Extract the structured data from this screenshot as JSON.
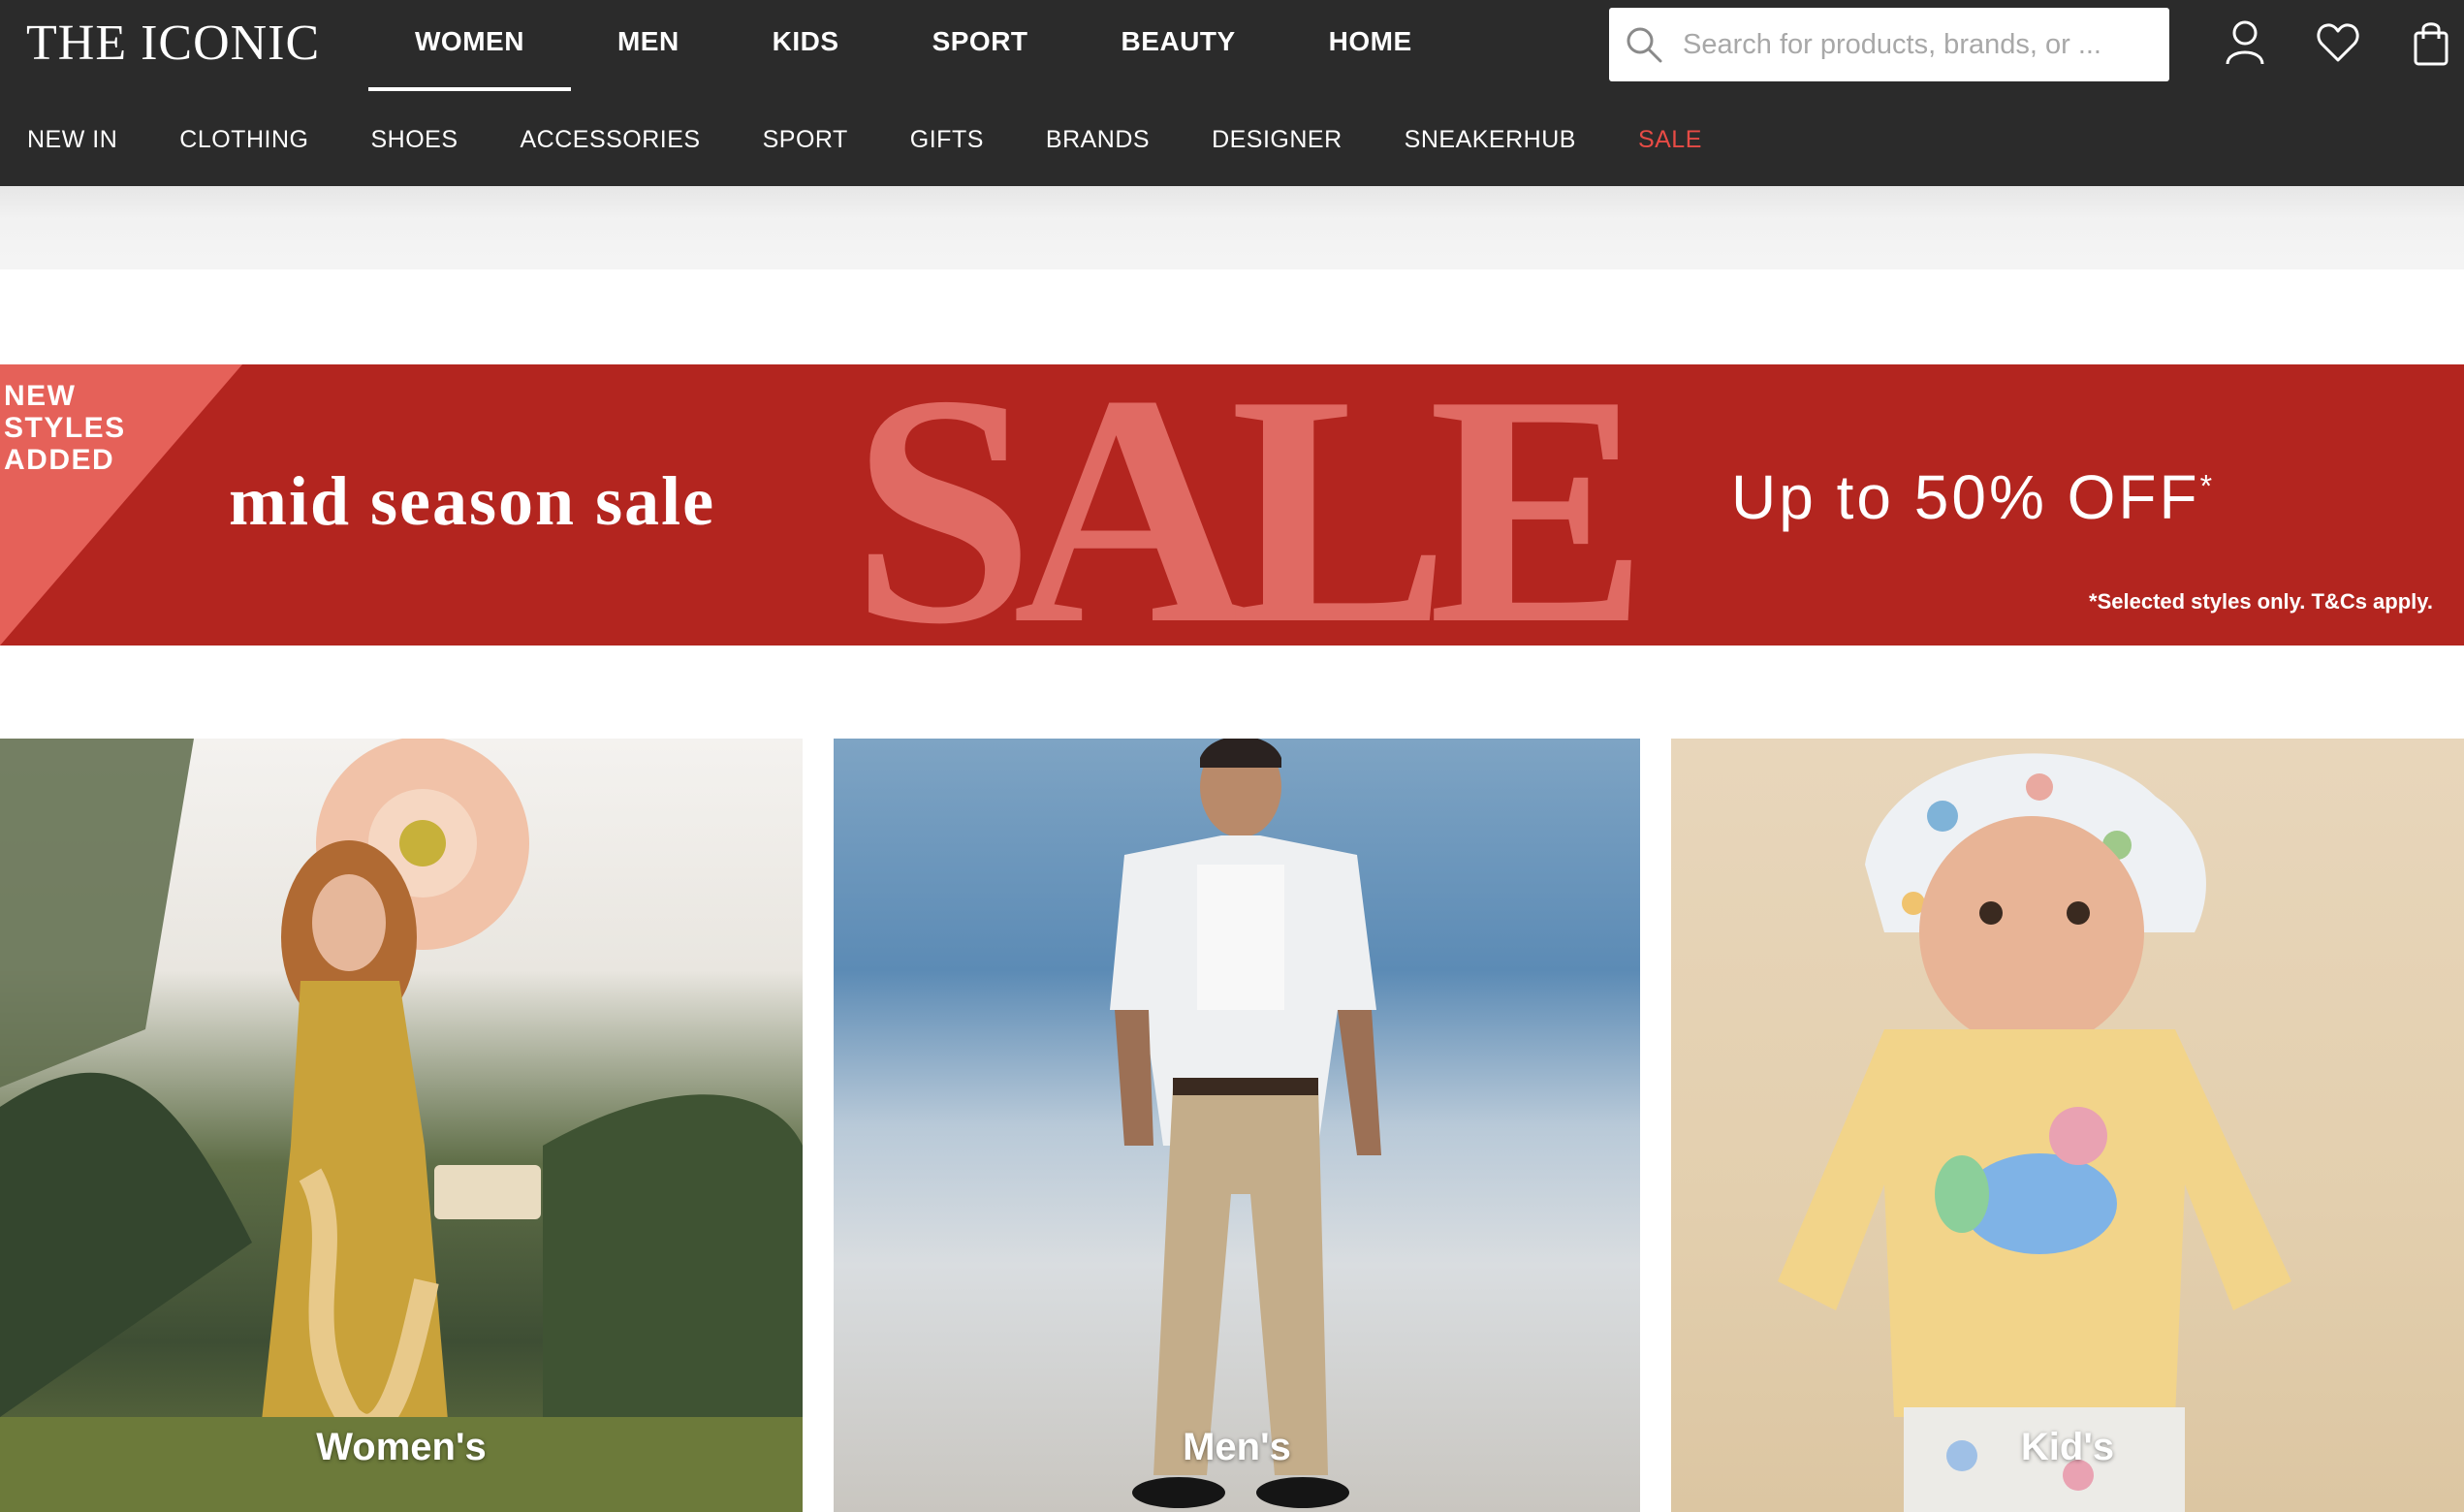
{
  "header": {
    "logo": "THE ICONIC",
    "departments": [
      {
        "label": "WOMEN",
        "active": true
      },
      {
        "label": "MEN",
        "active": false
      },
      {
        "label": "KIDS",
        "active": false
      },
      {
        "label": "SPORT",
        "active": false
      },
      {
        "label": "BEAUTY",
        "active": false
      },
      {
        "label": "HOME",
        "active": false
      }
    ],
    "search": {
      "placeholder": "Search for products, brands, or ...",
      "value": ""
    },
    "icons": [
      "search-icon",
      "account-icon",
      "wishlist-heart-icon",
      "shopping-bag-icon"
    ]
  },
  "category_nav": {
    "items": [
      {
        "label": "NEW IN"
      },
      {
        "label": "CLOTHING"
      },
      {
        "label": "SHOES"
      },
      {
        "label": "ACCESSORIES"
      },
      {
        "label": "SPORT"
      },
      {
        "label": "GIFTS"
      },
      {
        "label": "BRANDS"
      },
      {
        "label": "DESIGNER"
      },
      {
        "label": "SNEAKERHUB"
      },
      {
        "label": "SALE",
        "highlight": true
      }
    ],
    "sale_color": "#e74b45"
  },
  "banner": {
    "flag": "NEW STYLES ADDED",
    "title": "mid season sale",
    "big_word": "SALE",
    "offer": "Up to 50% OFF",
    "offer_mark": "*",
    "terms": "*Selected styles only. T&Cs apply.",
    "background_color": "#b3251f",
    "accent_color": "#e56159"
  },
  "tiles": [
    {
      "label": "Women's"
    },
    {
      "label": "Men's"
    },
    {
      "label": "Kid's"
    }
  ],
  "colors": {
    "header_bg": "#2b2b2b",
    "header_text": "#ffffff"
  }
}
